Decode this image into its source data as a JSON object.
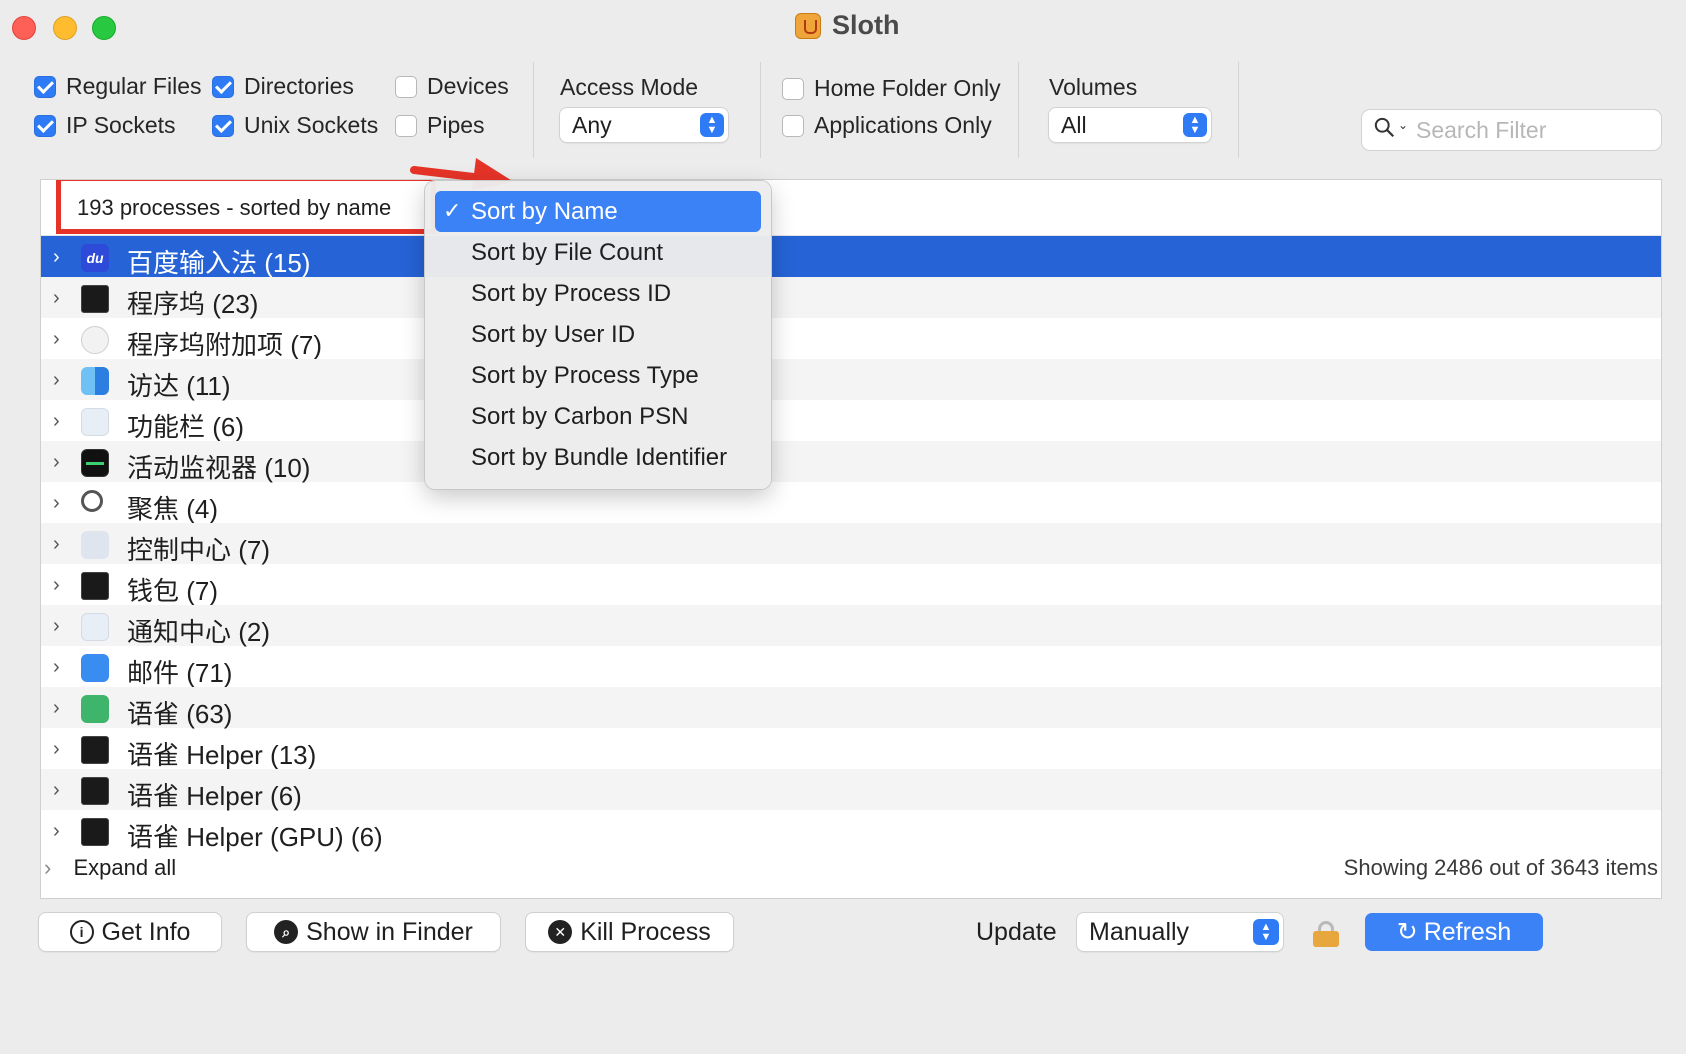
{
  "window": {
    "title": "Sloth"
  },
  "toolbar": {
    "checkboxes": [
      {
        "label": "Regular Files",
        "checked": true
      },
      {
        "label": "IP Sockets",
        "checked": true
      },
      {
        "label": "Directories",
        "checked": true
      },
      {
        "label": "Unix Sockets",
        "checked": true
      },
      {
        "label": "Devices",
        "checked": false
      },
      {
        "label": "Pipes",
        "checked": false
      },
      {
        "label": "Home Folder Only",
        "checked": false
      },
      {
        "label": "Applications Only",
        "checked": false
      }
    ],
    "access_mode": {
      "label": "Access Mode",
      "value": "Any"
    },
    "volumes": {
      "label": "Volumes",
      "value": "All"
    },
    "search": {
      "placeholder": "Search Filter"
    }
  },
  "table": {
    "header": "193 processes - sorted by name",
    "rows": [
      {
        "name": "百度输入法 (15)",
        "icon": "baidu-ime-icon",
        "selected": true
      },
      {
        "name": "程序坞 (23)",
        "icon": "terminal-icon"
      },
      {
        "name": "程序坞附加项 (7)",
        "icon": "shield-icon"
      },
      {
        "name": "访达 (11)",
        "icon": "finder-icon"
      },
      {
        "name": "功能栏 (6)",
        "icon": "grid-icon"
      },
      {
        "name": "活动监视器 (10)",
        "icon": "activity-monitor-icon"
      },
      {
        "name": "聚焦 (4)",
        "icon": "magnifier-icon"
      },
      {
        "name": "控制中心 (7)",
        "icon": "control-center-icon"
      },
      {
        "name": "钱包 (7)",
        "icon": "terminal-icon"
      },
      {
        "name": "通知中心 (2)",
        "icon": "grid-icon"
      },
      {
        "name": "邮件 (71)",
        "icon": "mail-icon"
      },
      {
        "name": "语雀 (63)",
        "icon": "yuque-icon"
      },
      {
        "name": "语雀 Helper (13)",
        "icon": "terminal-icon"
      },
      {
        "name": "语雀 Helper (6)",
        "icon": "terminal-icon"
      },
      {
        "name": "语雀 Helper (GPU) (6)",
        "icon": "terminal-icon"
      }
    ]
  },
  "sort_menu": {
    "check": "✓",
    "items": [
      {
        "label": "Sort by Name",
        "selected": true
      },
      {
        "label": "Sort by File Count"
      },
      {
        "label": "Sort by Process ID"
      },
      {
        "label": "Sort by User ID"
      },
      {
        "label": "Sort by Process Type"
      },
      {
        "label": "Sort by Carbon PSN"
      },
      {
        "label": "Sort by Bundle Identifier"
      }
    ]
  },
  "footer": {
    "expand_all": "Expand all",
    "status": "Showing 2486 out of 3643 items",
    "buttons": {
      "get_info": "Get Info",
      "show_in_finder": "Show in Finder",
      "kill_process": "Kill Process",
      "refresh": "Refresh"
    },
    "update": {
      "label": "Update",
      "value": "Manually"
    }
  },
  "colors": {
    "accent": "#2f7bf5",
    "selection": "#2563d6",
    "annotation": "#e63327"
  }
}
